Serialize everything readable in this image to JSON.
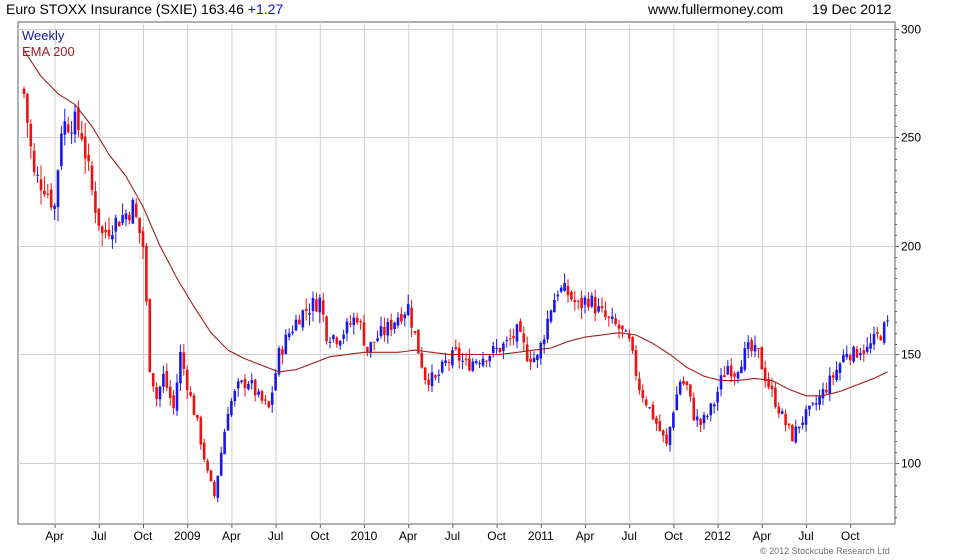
{
  "header": {
    "title": "Euro STOXX Insurance (SXIE) 163.46",
    "change": "+1.27",
    "site": "www.fullermoney.com",
    "date": "19 Dec 2012"
  },
  "footer": {
    "copyright": "© 2012 Stockcube Research Ltd"
  },
  "colors": {
    "up": "#1818e8",
    "down": "#f01010",
    "ema": "#a02020",
    "grid": "#d0d0d0",
    "legend_weekly": "#1a1aa0",
    "legend_ema": "#a02020"
  },
  "chart_data": {
    "type": "candlestick",
    "legend": [
      "Weekly",
      "EMA 200"
    ],
    "grid": true,
    "ylim": [
      72,
      303
    ],
    "y_ticks": [
      100,
      150,
      200,
      250,
      300
    ],
    "x_labels": [
      {
        "label": "Apr",
        "week": 9
      },
      {
        "label": "Jul",
        "week": 22
      },
      {
        "label": "Oct",
        "week": 35
      },
      {
        "label": "2009",
        "week": 48
      },
      {
        "label": "Apr",
        "week": 61
      },
      {
        "label": "Jul",
        "week": 74
      },
      {
        "label": "Oct",
        "week": 87
      },
      {
        "label": "2010",
        "week": 100
      },
      {
        "label": "Apr",
        "week": 113
      },
      {
        "label": "Jul",
        "week": 126
      },
      {
        "label": "Oct",
        "week": 139
      },
      {
        "label": "2011",
        "week": 152
      },
      {
        "label": "Apr",
        "week": 165
      },
      {
        "label": "Jul",
        "week": 178
      },
      {
        "label": "Oct",
        "week": 191
      },
      {
        "label": "2012",
        "week": 204
      },
      {
        "label": "Apr",
        "week": 217
      },
      {
        "label": "Jul",
        "week": 230
      },
      {
        "label": "Oct",
        "week": 243
      }
    ],
    "weeks": 255,
    "close_keypoints": [
      [
        0,
        270
      ],
      [
        3,
        232
      ],
      [
        6,
        228
      ],
      [
        9,
        218
      ],
      [
        11,
        255
      ],
      [
        14,
        258
      ],
      [
        17,
        252
      ],
      [
        20,
        225
      ],
      [
        23,
        205
      ],
      [
        26,
        210
      ],
      [
        30,
        215
      ],
      [
        32,
        218
      ],
      [
        35,
        200
      ],
      [
        37,
        145
      ],
      [
        39,
        130
      ],
      [
        41,
        140
      ],
      [
        44,
        125
      ],
      [
        46,
        150
      ],
      [
        49,
        130
      ],
      [
        51,
        118
      ],
      [
        54,
        95
      ],
      [
        56,
        85
      ],
      [
        58,
        105
      ],
      [
        60,
        125
      ],
      [
        63,
        135
      ],
      [
        66,
        138
      ],
      [
        69,
        130
      ],
      [
        72,
        125
      ],
      [
        75,
        150
      ],
      [
        78,
        160
      ],
      [
        81,
        168
      ],
      [
        84,
        172
      ],
      [
        87,
        175
      ],
      [
        89,
        160
      ],
      [
        92,
        158
      ],
      [
        95,
        162
      ],
      [
        98,
        168
      ],
      [
        101,
        152
      ],
      [
        104,
        158
      ],
      [
        107,
        162
      ],
      [
        110,
        168
      ],
      [
        113,
        172
      ],
      [
        116,
        152
      ],
      [
        118,
        140
      ],
      [
        121,
        138
      ],
      [
        124,
        146
      ],
      [
        127,
        150
      ],
      [
        130,
        145
      ],
      [
        133,
        148
      ],
      [
        136,
        150
      ],
      [
        139,
        152
      ],
      [
        142,
        155
      ],
      [
        145,
        160
      ],
      [
        148,
        150
      ],
      [
        151,
        148
      ],
      [
        153,
        160
      ],
      [
        155,
        172
      ],
      [
        157,
        180
      ],
      [
        160,
        178
      ],
      [
        163,
        172
      ],
      [
        166,
        176
      ],
      [
        169,
        170
      ],
      [
        172,
        165
      ],
      [
        175,
        162
      ],
      [
        178,
        155
      ],
      [
        181,
        135
      ],
      [
        184,
        125
      ],
      [
        187,
        115
      ],
      [
        189,
        108
      ],
      [
        191,
        125
      ],
      [
        193,
        138
      ],
      [
        195,
        135
      ],
      [
        197,
        122
      ],
      [
        199,
        118
      ],
      [
        201,
        122
      ],
      [
        203,
        128
      ],
      [
        205,
        138
      ],
      [
        207,
        145
      ],
      [
        209,
        142
      ],
      [
        211,
        148
      ],
      [
        213,
        152
      ],
      [
        216,
        150
      ],
      [
        218,
        140
      ],
      [
        220,
        132
      ],
      [
        222,
        125
      ],
      [
        224,
        118
      ],
      [
        226,
        112
      ],
      [
        228,
        118
      ],
      [
        230,
        122
      ],
      [
        232,
        125
      ],
      [
        234,
        130
      ],
      [
        236,
        135
      ],
      [
        238,
        140
      ],
      [
        240,
        146
      ],
      [
        242,
        152
      ],
      [
        244,
        150
      ],
      [
        246,
        153
      ],
      [
        248,
        152
      ],
      [
        250,
        156
      ],
      [
        252,
        160
      ],
      [
        254,
        163.46
      ]
    ],
    "ema_keypoints": [
      [
        0,
        290
      ],
      [
        5,
        278
      ],
      [
        10,
        270
      ],
      [
        15,
        265
      ],
      [
        20,
        255
      ],
      [
        25,
        242
      ],
      [
        30,
        232
      ],
      [
        35,
        218
      ],
      [
        40,
        200
      ],
      [
        45,
        185
      ],
      [
        50,
        172
      ],
      [
        55,
        160
      ],
      [
        60,
        152
      ],
      [
        65,
        148
      ],
      [
        70,
        145
      ],
      [
        75,
        142
      ],
      [
        80,
        143
      ],
      [
        85,
        146
      ],
      [
        90,
        149
      ],
      [
        95,
        150
      ],
      [
        100,
        151
      ],
      [
        105,
        151
      ],
      [
        110,
        151
      ],
      [
        115,
        152
      ],
      [
        120,
        151
      ],
      [
        125,
        150
      ],
      [
        130,
        150
      ],
      [
        135,
        150
      ],
      [
        140,
        150
      ],
      [
        145,
        151
      ],
      [
        150,
        152
      ],
      [
        155,
        153
      ],
      [
        160,
        156
      ],
      [
        165,
        158
      ],
      [
        170,
        159
      ],
      [
        175,
        160
      ],
      [
        180,
        159
      ],
      [
        185,
        155
      ],
      [
        190,
        150
      ],
      [
        195,
        144
      ],
      [
        200,
        140
      ],
      [
        205,
        138
      ],
      [
        210,
        138
      ],
      [
        215,
        139
      ],
      [
        220,
        138
      ],
      [
        225,
        134
      ],
      [
        230,
        131
      ],
      [
        235,
        131
      ],
      [
        240,
        133
      ],
      [
        245,
        136
      ],
      [
        250,
        139
      ],
      [
        254,
        142
      ]
    ]
  }
}
